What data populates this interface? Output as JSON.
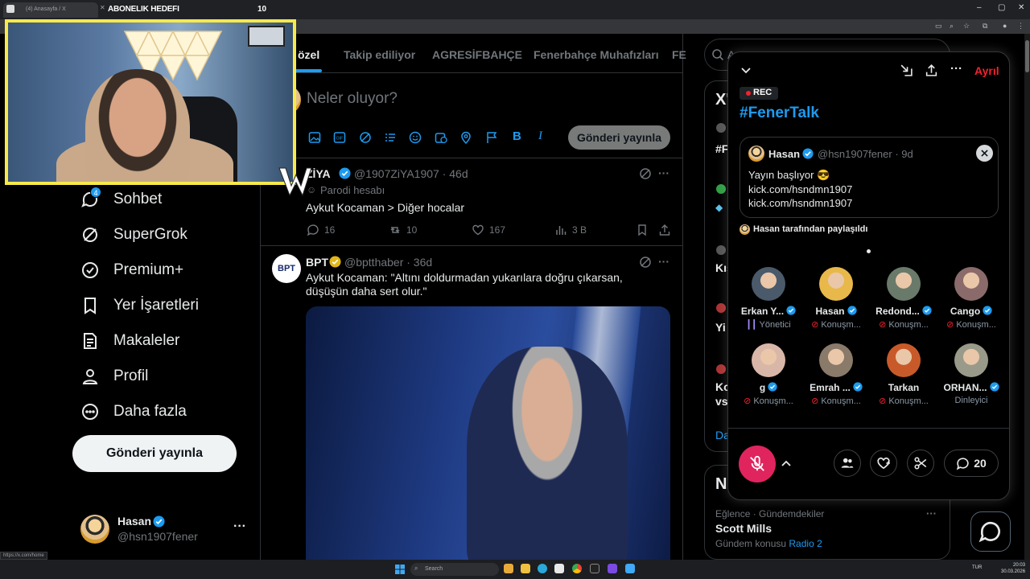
{
  "browser": {
    "tab_title": "(4) Anasayfa / X",
    "sub_goal_label": "ABONELIK HEDEFI",
    "sub_goal_count": "10",
    "url_tooltip": "https://x.com/home"
  },
  "nav": {
    "items": [
      {
        "label": "Sohbet",
        "icon": "chat-icon",
        "badge": "4"
      },
      {
        "label": "SuperGrok",
        "icon": "grok-icon"
      },
      {
        "label": "Premium+",
        "icon": "premium-icon"
      },
      {
        "label": "Yer İşaretleri",
        "icon": "bookmark-icon"
      },
      {
        "label": "Makaleler",
        "icon": "article-icon"
      },
      {
        "label": "Profil",
        "icon": "profile-icon"
      },
      {
        "label": "Daha fazla",
        "icon": "more-circle-icon"
      }
    ],
    "post_button": "Gönderi yayınla"
  },
  "account": {
    "name": "Hasan",
    "handle": "@hsn1907fener"
  },
  "feed": {
    "tabs": [
      "özel",
      "Takip ediliyor",
      "AGRESİFBAHÇE",
      "Fenerbahçe Muhafızları",
      "FE"
    ],
    "compose_placeholder": "Neler oluyor?",
    "compose_button": "Gönderi yayınla",
    "tweets": [
      {
        "name": "ZİYA",
        "handle": "@1907ZiYA1907 · 46d",
        "parody": "Parodi hesabı",
        "text": "Aykut Kocaman > Diğer hocalar",
        "replies": "16",
        "retweets": "10",
        "likes": "167",
        "views": "3 B"
      },
      {
        "name": "BPT",
        "avatar_text": "BPT",
        "handle": "@bptthaber · 36d",
        "text": "Aykut Kocaman: \"Altını doldurmadan yukarılara doğru çıkarsan, düşüşün daha sert olur.\""
      }
    ]
  },
  "right": {
    "search_placeholder": "A",
    "card1_initial": "X'",
    "card2_initial": "N",
    "trend": {
      "context": "Eğlence · Gündemdekiler",
      "title": "Scott Mills",
      "sub_prefix": "Gündem konusu ",
      "sub_link": "Radio 2"
    },
    "edge_fragments": [
      "#F",
      "Kış",
      "Yi",
      "Ko",
      "vs",
      "Da"
    ]
  },
  "space": {
    "rec": "REC",
    "title": "#FenerTalk",
    "leave": "Ayrıl",
    "pinned": {
      "name": "Hasan",
      "handle": "@hsn1907fener · 9d",
      "lines": [
        "Yayın başlıyor 😎",
        "kick.com/hsndmn1907",
        "kick.com/hsndmn1907"
      ]
    },
    "shared_by": "Hasan tarafından paylaşıldı",
    "participants": [
      {
        "name": "Erkan Y...",
        "role": "Yönetici",
        "verified": true,
        "color": "#4a5a6a"
      },
      {
        "name": "Hasan",
        "role": "Konuşm...",
        "verified": true,
        "color": "#e8b84a"
      },
      {
        "name": "Redond...",
        "role": "Konuşm...",
        "verified": true,
        "color": "#6a7a6a"
      },
      {
        "name": "Cango",
        "role": "Konuşm...",
        "verified": true,
        "color": "#8a6a6a"
      },
      {
        "name": "g",
        "role": "Konuşm...",
        "verified": true,
        "color": "#d9b7a8"
      },
      {
        "name": "Emrah ...",
        "role": "Konuşm...",
        "verified": true,
        "color": "#8a7a6a"
      },
      {
        "name": "Tarkan",
        "role": "Konuşm...",
        "verified": false,
        "color": "#c85a2a"
      },
      {
        "name": "ORHAN...",
        "role": "Dinleyici",
        "verified": true,
        "color": "#9a9a8a"
      }
    ],
    "chat_count": "20"
  },
  "taskbar": {
    "search": "Search",
    "lang": "TUR",
    "time": "20:03",
    "date": "30.03.2026"
  }
}
